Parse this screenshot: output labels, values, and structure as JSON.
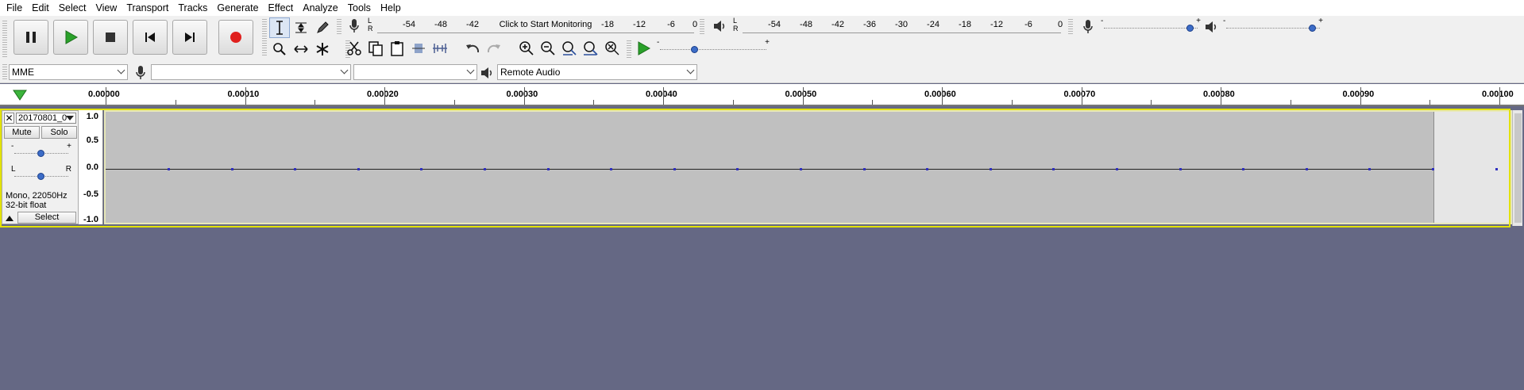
{
  "menu": [
    "File",
    "Edit",
    "Select",
    "View",
    "Transport",
    "Tracks",
    "Generate",
    "Effect",
    "Analyze",
    "Tools",
    "Help"
  ],
  "record_meter": {
    "ticks": [
      "-54",
      "-48",
      "-42",
      "-18",
      "-12",
      "-6",
      "0"
    ],
    "prompt": "Click to Start Monitoring",
    "channels": [
      "L",
      "R"
    ]
  },
  "playback_meter": {
    "ticks": [
      "-54",
      "-48",
      "-42",
      "-36",
      "-30",
      "-24",
      "-18",
      "-12",
      "-6",
      "0"
    ],
    "channels": [
      "L",
      "R"
    ]
  },
  "mixer": {
    "record_volume": 0.92,
    "playback_volume": 0.92,
    "minus": "-",
    "plus": "+"
  },
  "play_at_speed": {
    "minus": "-",
    "plus": "+",
    "value": 0.33
  },
  "device": {
    "host": "MME",
    "recording_device": "",
    "recording_channels": "",
    "playback_device": "Remote Audio"
  },
  "ruler": {
    "labels": [
      "0.00000",
      "0.00010",
      "0.00020",
      "0.00030",
      "0.00040",
      "0.00050",
      "0.00060",
      "0.00070",
      "0.00080",
      "0.00090",
      "0.00100"
    ]
  },
  "track": {
    "name": "20170801_0",
    "mute": "Mute",
    "solo": "Solo",
    "gain_minus": "-",
    "gain_plus": "+",
    "pan_left": "L",
    "pan_right": "R",
    "gain": 0.5,
    "pan": 0.5,
    "info_line1": "Mono, 22050Hz",
    "info_line2": "32-bit float",
    "select": "Select",
    "scale": [
      "1.0",
      "0.5",
      "0.0",
      "-0.5",
      "-1.0"
    ],
    "sample_count": 22
  },
  "colors": {
    "background": "#656884",
    "clip": "#c0c0c0",
    "record": "#e0201e",
    "play": "#2aa12a",
    "track_border": "#e2e200"
  }
}
